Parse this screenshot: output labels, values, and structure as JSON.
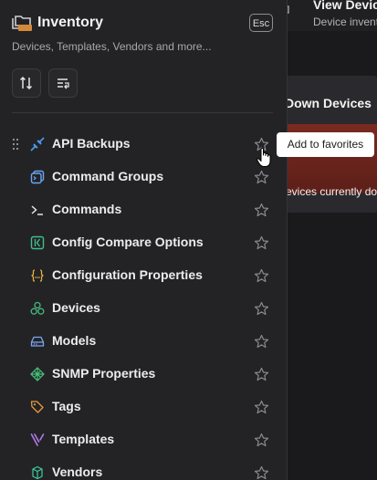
{
  "background": {
    "top_title": "View Devic",
    "top_subtitle": "Device invent",
    "card_title": "Down Devices",
    "card_text": "evices currently do"
  },
  "panel": {
    "title": "Inventory",
    "subtitle": "Devices, Templates, Vendors and more...",
    "esc_label": "Esc",
    "header_icon": "folders-icon",
    "tools": [
      {
        "icon": "sort-icon"
      },
      {
        "icon": "list-filter-icon"
      }
    ],
    "items": [
      {
        "label": "API Backups",
        "icon": "plug-icon",
        "color": "#4a9cf0"
      },
      {
        "label": "Command Groups",
        "icon": "terminal-square-icon",
        "color": "#6aa7f2"
      },
      {
        "label": "Commands",
        "icon": "terminal-prompt-icon",
        "color": "#e5e5e8"
      },
      {
        "label": "Config Compare Options",
        "icon": "compare-icon",
        "color": "#3fbf8a"
      },
      {
        "label": "Configuration Properties",
        "icon": "braces-icon",
        "color": "#e2b23a"
      },
      {
        "label": "Devices",
        "icon": "devices-icon",
        "color": "#45b97a"
      },
      {
        "label": "Models",
        "icon": "hard-drive-icon",
        "color": "#7aa7f0"
      },
      {
        "label": "SNMP Properties",
        "icon": "network-icon",
        "color": "#47c07a"
      },
      {
        "label": "Tags",
        "icon": "tags-icon",
        "color": "#e89a3c"
      },
      {
        "label": "Templates",
        "icon": "template-icon",
        "color": "#b27ae8"
      },
      {
        "label": "Vendors",
        "icon": "vendors-icon",
        "color": "#3fc9a0"
      }
    ],
    "tooltip": "Add to favorites"
  },
  "colors": {
    "panel_bg": "#232326",
    "text": "#ececee",
    "muted": "#a8a8ad",
    "alert_red": "#6a241c",
    "star": "#8a8a90"
  }
}
